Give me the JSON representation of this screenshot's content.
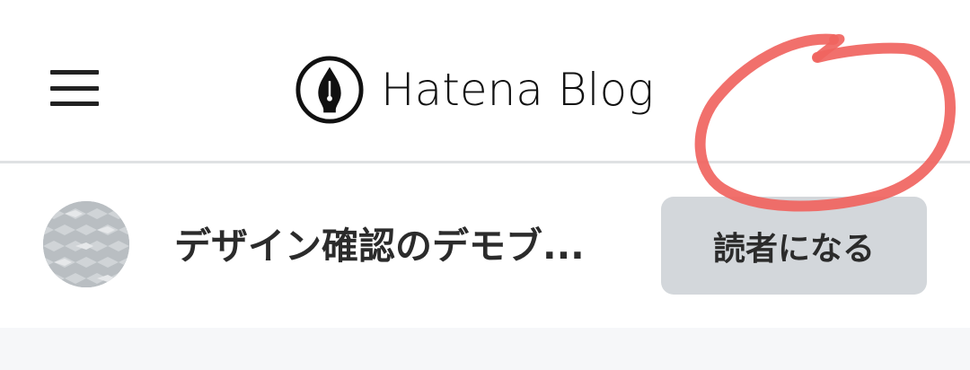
{
  "header": {
    "menu_icon": "hamburger-menu-icon",
    "logo_icon": "fountain-pen-nib-icon",
    "logo_text": "Hatena Blog"
  },
  "blog": {
    "avatar_icon": "diamond-pattern-avatar",
    "title": "デザイン確認のデモブ...",
    "subscribe_label": "読者になる"
  },
  "annotation": {
    "type": "hand-drawn-circle",
    "color": "#f0645f"
  },
  "colors": {
    "divider": "#dfe1e3",
    "button_bg": "#d3d7db",
    "content_bg": "#f6f7f9",
    "text": "#2b2b2b"
  }
}
